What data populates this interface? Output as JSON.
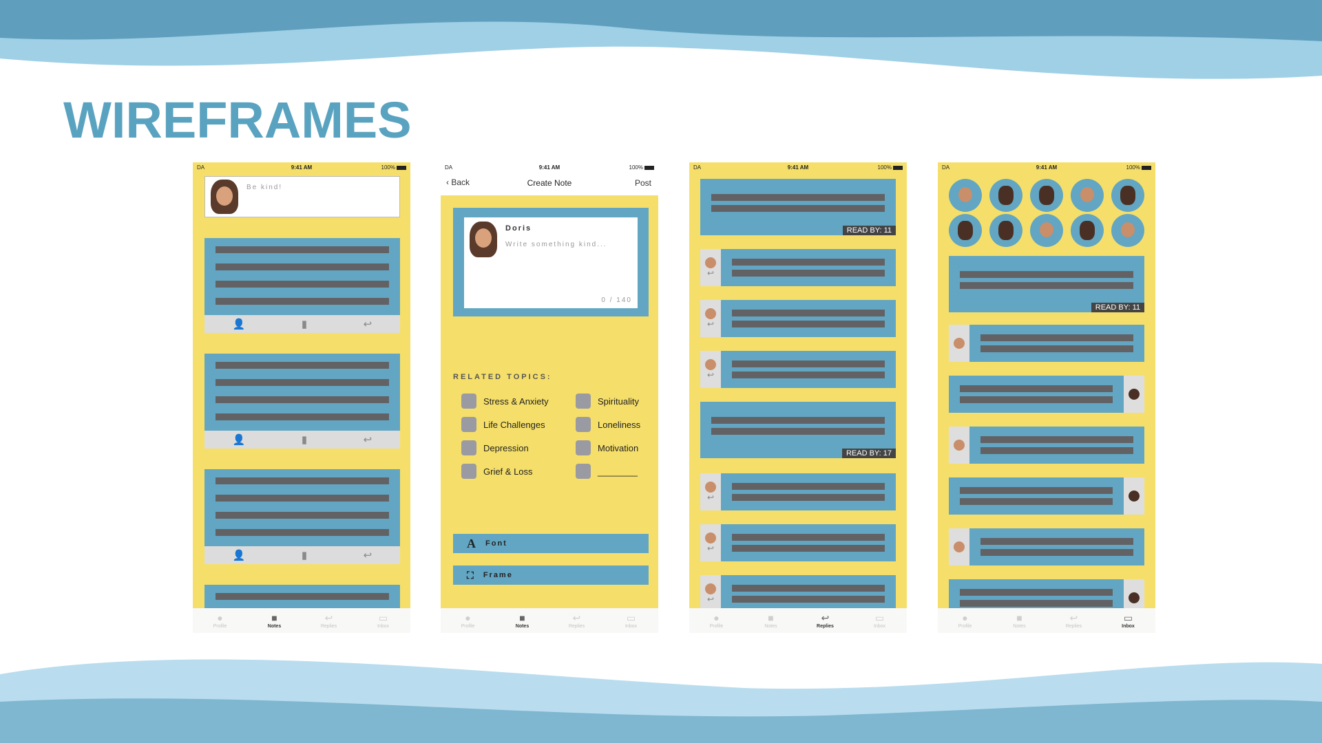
{
  "slide": {
    "title": "WIREFRAMES"
  },
  "colors": {
    "accent": "#5aa3c0",
    "phone_bg": "#f5df6a",
    "card": "#62a6c3",
    "bar": "#626265"
  },
  "status": {
    "signal": "DA",
    "time": "9:41 AM",
    "battery": "100%"
  },
  "tabs": [
    "Profile",
    "Notes",
    "Replies",
    "Inbox"
  ],
  "phone1": {
    "compose_placeholder": "Be kind!"
  },
  "phone2": {
    "nav": {
      "back": "Back",
      "title": "Create Note",
      "post": "Post"
    },
    "author": "Doris",
    "note_placeholder": "Write something kind...",
    "counter": "0 / 140",
    "related_title": "RELATED TOPICS:",
    "topics_left": [
      "Stress & Anxiety",
      "Life Challenges",
      "Depression",
      "Grief & Loss"
    ],
    "topics_right": [
      "Spirituality",
      "Loneliness",
      "Motivation",
      "________"
    ],
    "font_button": "Font",
    "frame_button": "Frame"
  },
  "phone3": {
    "read_by_1": "READ BY: 11",
    "read_by_2": "READ BY: 17"
  },
  "phone4": {
    "read_by": "READ BY: 11"
  },
  "icons": [
    "person-add-icon",
    "bookmark-icon",
    "reply-icon",
    "profile-icon",
    "notes-icon",
    "replies-icon",
    "inbox-icon",
    "chevron-left-icon",
    "font-icon",
    "frame-icon"
  ]
}
